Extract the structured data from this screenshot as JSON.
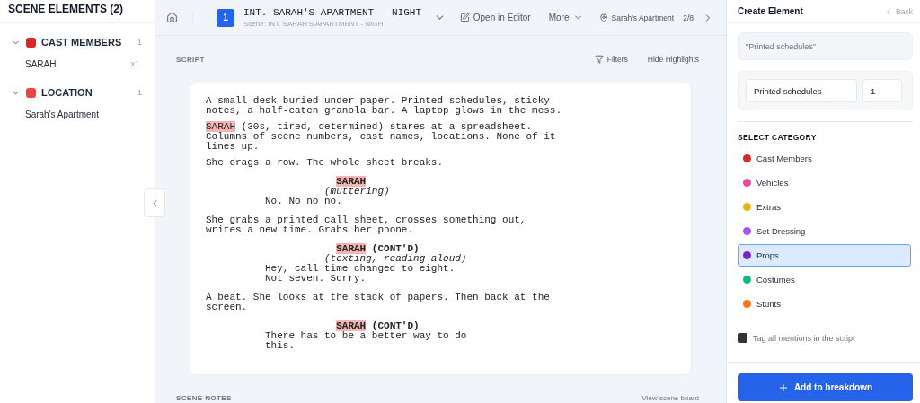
{
  "sidebar": {
    "title": "SCENE ELEMENTS (2)",
    "groups": [
      {
        "label": "CAST MEMBERS",
        "color": "#dc2626",
        "count": "1",
        "expanded": true,
        "items": [
          {
            "name": "SARAH",
            "count": "x1"
          }
        ]
      },
      {
        "label": "LOCATION",
        "color": "#ef4444",
        "count": "1",
        "expanded": true,
        "items": [
          {
            "name": "Sarah's Apartment"
          }
        ]
      }
    ]
  },
  "topbar": {
    "scene_number": "1",
    "scene_heading": "INT. SARAH'S APARTMENT - NIGHT",
    "scene_subtitle": "Scene: INT. SARAH'S APARTMENT - NIGHT",
    "open_editor": "Open in Editor",
    "more": "More",
    "location": "Sarah's Apartment",
    "position": "2/8"
  },
  "script": {
    "label": "SCRIPT",
    "filters": "Filters",
    "hide_highlights": "Hide Highlights",
    "blocks": [
      {
        "kind": "action",
        "parts": [
          {
            "text": "A small desk buried under paper. Printed schedules, sticky notes, a half-eaten granola bar. A laptop glows in the mess.",
            "highlighted": false
          }
        ]
      },
      {
        "kind": "action",
        "parts": [
          {
            "text": "SARAH",
            "highlighted": true
          },
          {
            "text": " (30s, tired, determined) stares at a spreadsheet. Columns of scene numbers, cast names, locations. None of it lines up.",
            "highlighted": false
          }
        ]
      },
      {
        "kind": "action",
        "parts": [
          {
            "text": "She drags a row. The whole sheet breaks.",
            "highlighted": false
          }
        ]
      },
      {
        "kind": "character",
        "name": "SARAH",
        "highlighted": true
      },
      {
        "kind": "parenthetical",
        "text": "(muttering)"
      },
      {
        "kind": "dialogue",
        "text": "No. No no no."
      },
      {
        "kind": "action",
        "parts": [
          {
            "text": "She grabs a printed call sheet, crosses something out, writes a new time. Grabs her phone.",
            "highlighted": false
          }
        ]
      },
      {
        "kind": "character",
        "name": "SARAH",
        "highlighted": true,
        "extension": "(CONT'D)"
      },
      {
        "kind": "parenthetical",
        "text": "(texting, reading aloud)"
      },
      {
        "kind": "dialogue",
        "text": "Hey, call time changed to eight. Not seven. Sorry."
      },
      {
        "kind": "action",
        "parts": [
          {
            "text": "A beat. She looks at the stack of papers. Then back at the screen.",
            "highlighted": false
          }
        ]
      },
      {
        "kind": "character",
        "name": "SARAH",
        "highlighted": true,
        "extension": "(CONT'D)"
      },
      {
        "kind": "dialogue",
        "text": "There has to be a better way to do this."
      }
    ]
  },
  "notes": {
    "label": "SCENE NOTES",
    "link": "View scene board"
  },
  "panel": {
    "title": "Create Element",
    "back": "Back",
    "selection": "\"Printed schedules\"",
    "name_value": "Printed schedules",
    "quantity_value": "1",
    "category_label": "SELECT CATEGORY",
    "categories": [
      {
        "label": "Cast Members",
        "color": "#dc2626",
        "selected": false
      },
      {
        "label": "Vehicles",
        "color": "#ec4899",
        "selected": false
      },
      {
        "label": "Extras",
        "color": "#eab308",
        "selected": false
      },
      {
        "label": "Set Dressing",
        "color": "#a855f7",
        "selected": false
      },
      {
        "label": "Props",
        "color": "#7e22ce",
        "selected": true
      },
      {
        "label": "Costumes",
        "color": "#10b981",
        "selected": false
      },
      {
        "label": "Stunts",
        "color": "#f97316",
        "selected": false
      }
    ],
    "tag_all": {
      "label": "Tag all mentions in the script",
      "checked": false
    },
    "add_button": "Add to breakdown"
  }
}
